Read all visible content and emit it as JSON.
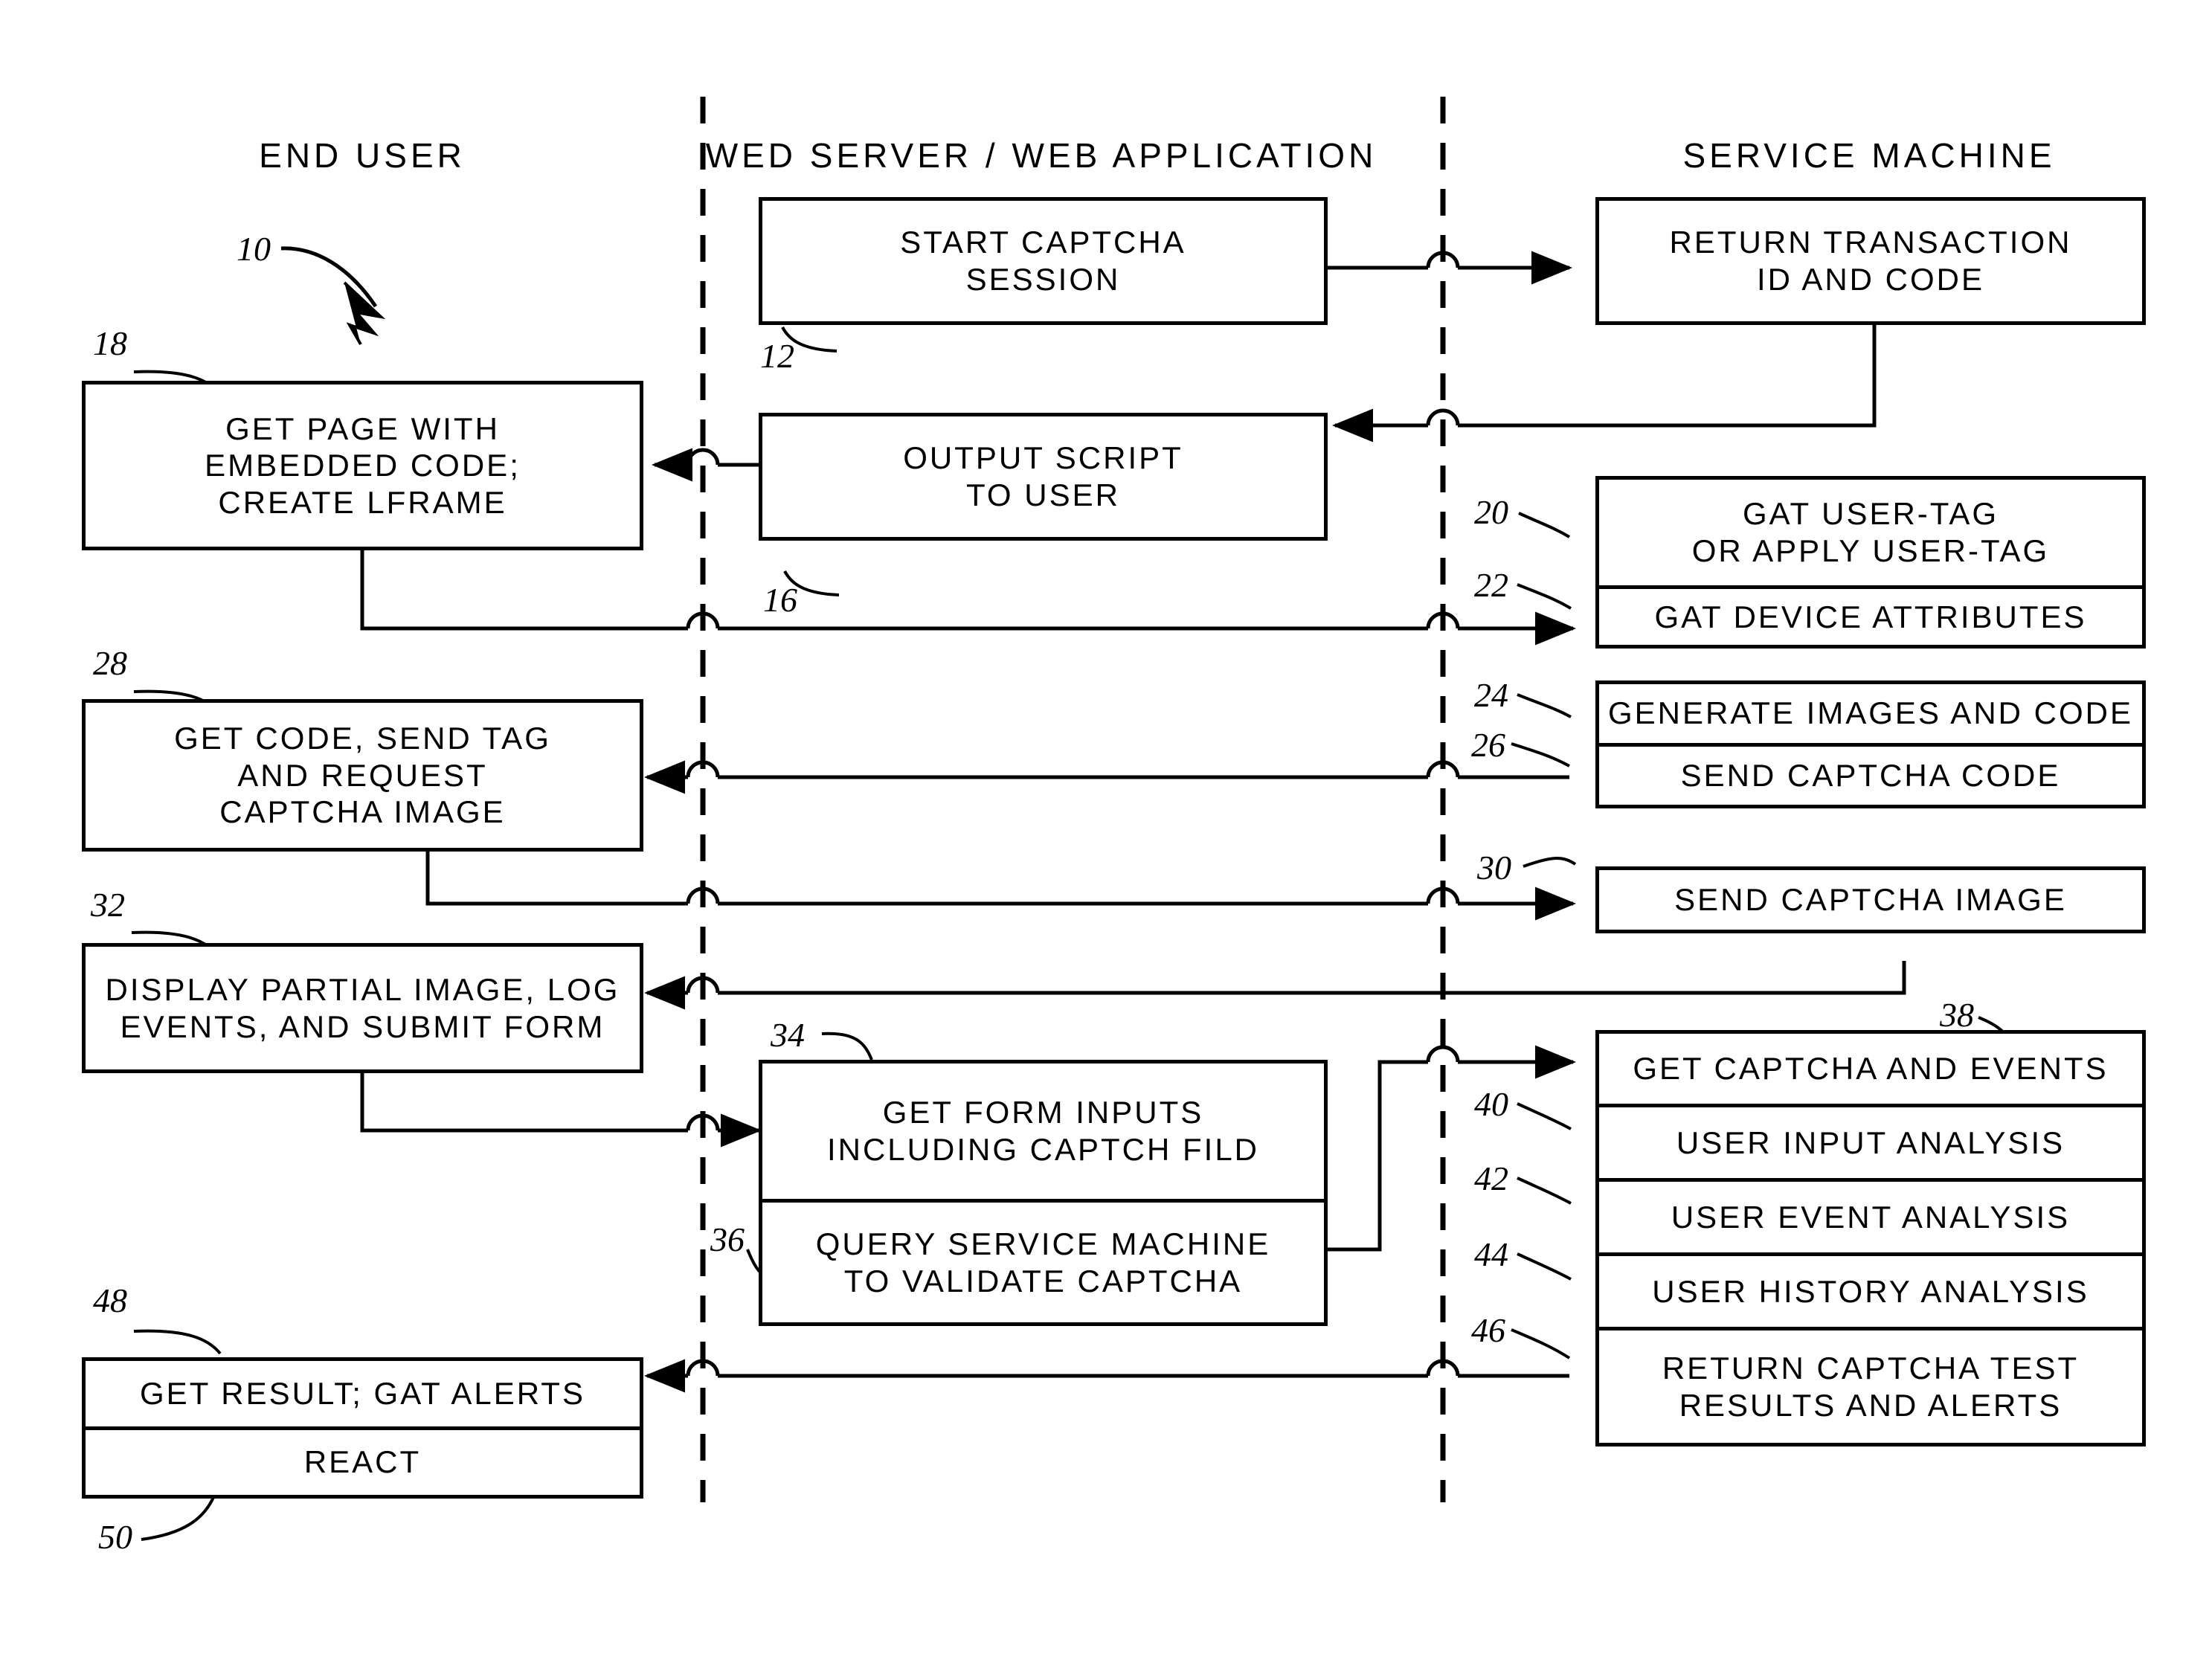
{
  "figure": {
    "label": "10",
    "type": "swimlane-flowchart",
    "columns": [
      {
        "id": "end-user",
        "title": "END USER"
      },
      {
        "id": "web-server",
        "title": "WED SERVER / WEB APPLICATION"
      },
      {
        "id": "service-machine",
        "title": "SERVICE MACHINE"
      }
    ]
  },
  "nodes": {
    "n12": {
      "ref": "12",
      "column": "web-server",
      "lines": [
        "START CAPTCHA",
        "SESSION"
      ]
    },
    "n14": {
      "ref": "",
      "column": "service-machine",
      "lines": [
        "RETURN TRANSACTION",
        "ID AND CODE"
      ]
    },
    "n18": {
      "ref": "18",
      "column": "end-user",
      "lines": [
        "GET PAGE WITH",
        "EMBEDDED CODE;",
        "CREATE LFRAME"
      ]
    },
    "n16": {
      "ref": "16",
      "column": "web-server",
      "lines": [
        "OUTPUT SCRIPT",
        "TO USER"
      ]
    },
    "n20": {
      "ref": "20",
      "column": "service-machine",
      "lines": [
        "GAT USER-TAG",
        "OR APPLY USER-TAG"
      ]
    },
    "n22": {
      "ref": "22",
      "column": "service-machine",
      "lines": [
        "GAT DEVICE ATTRIBUTES"
      ]
    },
    "n24": {
      "ref": "24",
      "column": "service-machine",
      "lines": [
        "GENERATE IMAGES AND CODE"
      ]
    },
    "n26": {
      "ref": "26",
      "column": "service-machine",
      "lines": [
        "SEND CAPTCHA CODE"
      ]
    },
    "n28": {
      "ref": "28",
      "column": "end-user",
      "lines": [
        "GET CODE, SEND TAG",
        "AND REQUEST",
        "CAPTCHA IMAGE"
      ]
    },
    "n30": {
      "ref": "30",
      "column": "service-machine",
      "lines": [
        "SEND CAPTCHA IMAGE"
      ]
    },
    "n32": {
      "ref": "32",
      "column": "end-user",
      "lines": [
        "DISPLAY PARTIAL IMAGE, LOG",
        "EVENTS, AND SUBMIT FORM"
      ]
    },
    "n34": {
      "ref": "34",
      "column": "web-server",
      "lines": [
        "GET FORM INPUTS",
        "INCLUDING CAPTCH FILD"
      ]
    },
    "n36": {
      "ref": "36",
      "column": "web-server",
      "lines": [
        "QUERY SERVICE MACHINE",
        "TO VALIDATE CAPTCHA"
      ]
    },
    "n38": {
      "ref": "38",
      "column": "service-machine",
      "lines": [
        "GET CAPTCHA AND EVENTS"
      ]
    },
    "n40": {
      "ref": "40",
      "column": "service-machine",
      "lines": [
        "USER INPUT ANALYSIS"
      ]
    },
    "n42": {
      "ref": "42",
      "column": "service-machine",
      "lines": [
        "USER EVENT ANALYSIS"
      ]
    },
    "n44": {
      "ref": "44",
      "column": "service-machine",
      "lines": [
        "USER HISTORY ANALYSIS"
      ]
    },
    "n46": {
      "ref": "46",
      "column": "service-machine",
      "lines": [
        "RETURN CAPTCHA TEST",
        "RESULTS AND ALERTS"
      ]
    },
    "n48": {
      "ref": "48",
      "column": "end-user",
      "lines": [
        "GET RESULT; GAT ALERTS"
      ]
    },
    "n50": {
      "ref": "50",
      "column": "end-user",
      "lines": [
        "REACT"
      ]
    }
  },
  "ref_labels": {
    "r10": "10",
    "r12": "12",
    "r16": "16",
    "r18": "18",
    "r20": "20",
    "r22": "22",
    "r24": "24",
    "r26": "26",
    "r28": "28",
    "r30": "30",
    "r32": "32",
    "r34": "34",
    "r36": "36",
    "r38": "38",
    "r40": "40",
    "r42": "42",
    "r44": "44",
    "r46": "46",
    "r48": "48",
    "r50": "50"
  },
  "colors": {
    "ink": "#000000",
    "paper": "#ffffff"
  }
}
